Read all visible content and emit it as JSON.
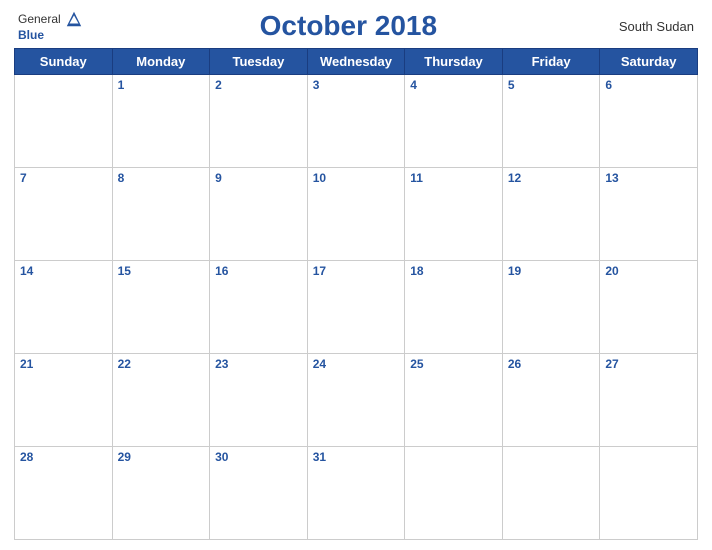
{
  "header": {
    "logo_general": "General",
    "logo_blue": "Blue",
    "month_title": "October 2018",
    "country": "South Sudan"
  },
  "weekdays": [
    "Sunday",
    "Monday",
    "Tuesday",
    "Wednesday",
    "Thursday",
    "Friday",
    "Saturday"
  ],
  "weeks": [
    [
      null,
      1,
      2,
      3,
      4,
      5,
      6
    ],
    [
      7,
      8,
      9,
      10,
      11,
      12,
      13
    ],
    [
      14,
      15,
      16,
      17,
      18,
      19,
      20
    ],
    [
      21,
      22,
      23,
      24,
      25,
      26,
      27
    ],
    [
      28,
      29,
      30,
      31,
      null,
      null,
      null
    ]
  ]
}
